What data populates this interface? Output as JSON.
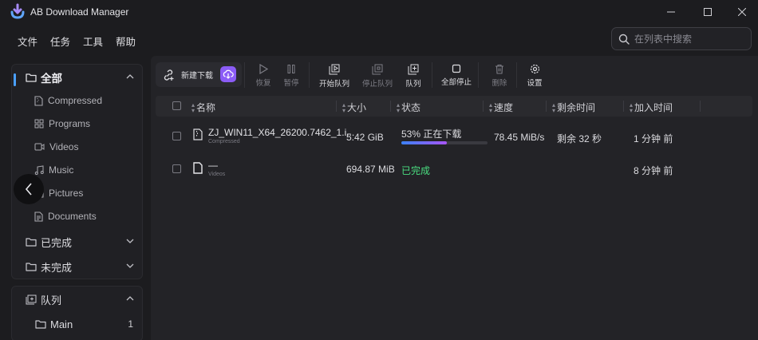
{
  "app": {
    "title": "AB Download Manager"
  },
  "menu": [
    "文件",
    "任务",
    "工具",
    "帮助"
  ],
  "search": {
    "placeholder": "在列表中搜索"
  },
  "sidebar": {
    "all_label": "全部",
    "categories": [
      {
        "label": "Compressed",
        "icon": "zip-file-icon"
      },
      {
        "label": "Programs",
        "icon": "apps-icon"
      },
      {
        "label": "Videos",
        "icon": "video-icon"
      },
      {
        "label": "Music",
        "icon": "music-icon"
      },
      {
        "label": "Pictures",
        "icon": "image-icon"
      },
      {
        "label": "Documents",
        "icon": "document-icon"
      }
    ],
    "finished_label": "已完成",
    "unfinished_label": "未完成",
    "queues_label": "队列",
    "queues": [
      {
        "label": "Main",
        "count": "1"
      }
    ]
  },
  "toolbar": {
    "new_download": "新建下载",
    "resume": "恢复",
    "pause": "暂停",
    "start_queue": "开始队列",
    "stop_queue": "停止队列",
    "queue": "队列",
    "stop_all": "全部停止",
    "delete": "删除",
    "settings": "设置"
  },
  "table": {
    "columns": [
      "名称",
      "大小",
      "状态",
      "速度",
      "剩余时间",
      "加入时间"
    ],
    "rows": [
      {
        "name": "ZJ_WIN11_X64_26200.7462_1.i...",
        "category": "Compressed",
        "size": "5.42 GiB",
        "status": "53% 正在下载",
        "progress": 0.53,
        "speed": "78.45 MiB/s",
        "remaining": "剩余 32 秒",
        "added": "1 分钟 前"
      },
      {
        "name": "—",
        "category": "Videos",
        "size": "694.87 MiB",
        "status": "已完成",
        "speed": "",
        "remaining": "",
        "added": "8 分钟 前"
      }
    ]
  },
  "colors": {
    "accent": "#4aa0ff",
    "brand": "#8b5cf6",
    "success": "#4ade80",
    "background": "#1c1c1f"
  }
}
